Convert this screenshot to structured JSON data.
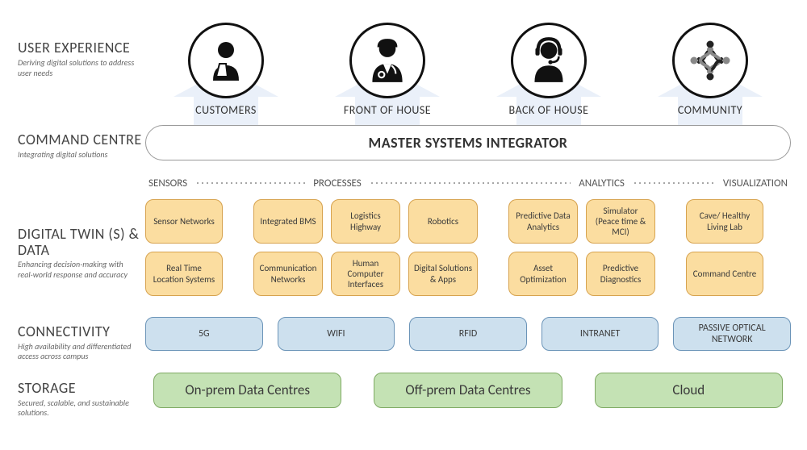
{
  "rows": {
    "ux": {
      "title": "USER EXPERIENCE",
      "desc": "Deriving digital solutions to address user needs"
    },
    "cmd": {
      "title": "COMMAND CENTRE",
      "desc": "Integrating digital solutions",
      "msi": "MASTER SYSTEMS INTEGRATOR"
    },
    "twin": {
      "title": "DIGITAL TWIN (S) & DATA",
      "desc": "Enhancing decision-making with real-world response and accuracy"
    },
    "conn": {
      "title": "CONNECTIVITY",
      "desc": "High availability and differentiated access across campus"
    },
    "stor": {
      "title": "STORAGE",
      "desc": "Secured, scalable, and sustainable solutions."
    }
  },
  "personas": [
    {
      "label": "CUSTOMERS"
    },
    {
      "label": "FRONT OF HOUSE"
    },
    {
      "label": "BACK OF HOUSE"
    },
    {
      "label": "COMMUNITY"
    }
  ],
  "categories": [
    "SENSORS",
    "PROCESSES",
    "ANALYTICS",
    "VISUALIZATION"
  ],
  "twin": {
    "sensors": {
      "row1": [
        "Sensor Networks"
      ],
      "row2": [
        "Real Time Location Systems"
      ]
    },
    "processes": {
      "row1": [
        "Integrated BMS",
        "Logistics Highway",
        "Robotics"
      ],
      "row2": [
        "Communication Networks",
        "Human Computer Interfaces",
        "Digital Solutions & Apps"
      ]
    },
    "analytics": {
      "row1": [
        "Predictive Data Analytics",
        "Simulator (Peace time & MCI)"
      ],
      "row2": [
        "Asset Optimization",
        "Predictive Diagnostics"
      ]
    },
    "visualization": {
      "row1": [
        "Cave/ Healthy Living Lab"
      ],
      "row2": [
        "Command Centre"
      ]
    }
  },
  "connectivity": [
    "5G",
    "WIFI",
    "RFID",
    "INTRANET",
    "PASSIVE OPTICAL NETWORK"
  ],
  "storage": [
    "On-prem Data Centres",
    "Off-prem Data Centres",
    "Cloud"
  ]
}
